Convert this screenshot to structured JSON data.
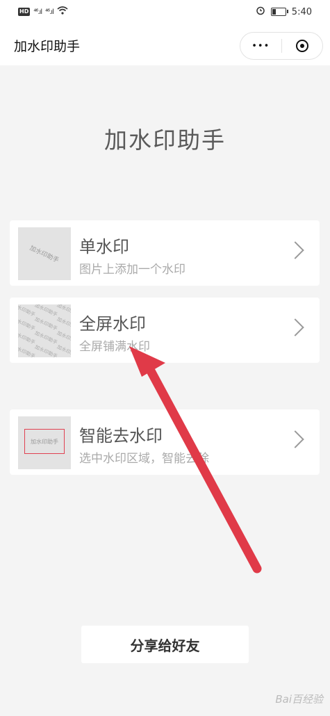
{
  "status_bar": {
    "hd_badge": "HD",
    "signal_1": "⁴⁶.ıl",
    "signal_2": "⁴⁶.ıl",
    "time": "5:40"
  },
  "nav": {
    "title": "加水印助手",
    "more_icon": "•••"
  },
  "heading": "加水印助手",
  "cards": [
    {
      "title": "单水印",
      "subtitle": "图片上添加一个水印",
      "thumb_text": "加水印助手"
    },
    {
      "title": "全屏水印",
      "subtitle": "全屏铺满水印",
      "thumb_text": "加水印助手"
    },
    {
      "title": "智能去水印",
      "subtitle": "选中水印区域，智能去除",
      "thumb_text": "加水印助手"
    }
  ],
  "share_label": "分享给好友",
  "watermark": "Bai百经验",
  "colors": {
    "arrow": "#e03a48",
    "box_border": "#e04050",
    "background": "#f4f4f4"
  }
}
